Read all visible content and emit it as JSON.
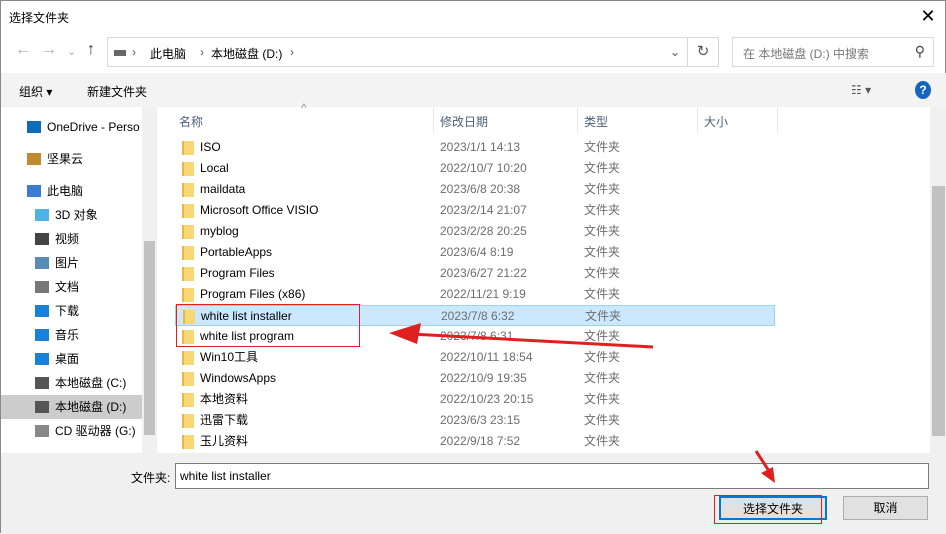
{
  "window": {
    "title": "选择文件夹",
    "close": "✕"
  },
  "nav": {
    "back": "←",
    "forward": "→",
    "recent": "⌄",
    "up": "↑"
  },
  "address": {
    "crumbs": [
      "此电脑",
      "本地磁盘 (D:)"
    ],
    "sep": "›",
    "dropdown": "⌄",
    "refresh": "↻"
  },
  "search": {
    "placeholder": "在 本地磁盘 (D:) 中搜索",
    "icon": "⚲"
  },
  "toolbar": {
    "organize": "组织 ▾",
    "new_folder": "新建文件夹",
    "view": "☷ ▾",
    "help": "?"
  },
  "sidebar": {
    "items": [
      {
        "label": "OneDrive - Perso",
        "icon": "cloud-icon",
        "color": "#0f6cbd"
      },
      {
        "label": "坚果云",
        "icon": "nut-icon",
        "color": "#c08a2e"
      },
      {
        "label": "此电脑",
        "icon": "computer-icon",
        "color": "#3a7bd5"
      },
      {
        "label": "3D 对象",
        "icon": "cube-icon",
        "color": "#4fb3e8"
      },
      {
        "label": "视频",
        "icon": "video-icon",
        "color": "#444"
      },
      {
        "label": "图片",
        "icon": "picture-icon",
        "color": "#5a8bb5"
      },
      {
        "label": "文档",
        "icon": "document-icon",
        "color": "#777"
      },
      {
        "label": "下载",
        "icon": "download-icon",
        "color": "#1e7fd6"
      },
      {
        "label": "音乐",
        "icon": "music-icon",
        "color": "#1e7fd6"
      },
      {
        "label": "桌面",
        "icon": "desktop-icon",
        "color": "#1e7fd6"
      },
      {
        "label": "本地磁盘 (C:)",
        "icon": "drive-icon",
        "color": "#555"
      },
      {
        "label": "本地磁盘 (D:)",
        "icon": "drive-icon",
        "color": "#555",
        "selected": true
      },
      {
        "label": "CD 驱动器 (G:)",
        "icon": "cd-icon",
        "color": "#888"
      }
    ]
  },
  "columns": [
    "名称",
    "修改日期",
    "类型",
    "大小"
  ],
  "files": [
    {
      "name": "ISO",
      "date": "2023/1/1 14:13",
      "type": "文件夹"
    },
    {
      "name": "Local",
      "date": "2022/10/7 10:20",
      "type": "文件夹"
    },
    {
      "name": "maildata",
      "date": "2023/6/8 20:38",
      "type": "文件夹"
    },
    {
      "name": "Microsoft Office VISIO",
      "date": "2023/2/14 21:07",
      "type": "文件夹"
    },
    {
      "name": "myblog",
      "date": "2023/2/28 20:25",
      "type": "文件夹"
    },
    {
      "name": "PortableApps",
      "date": "2023/6/4 8:19",
      "type": "文件夹"
    },
    {
      "name": "Program Files",
      "date": "2023/6/27 21:22",
      "type": "文件夹"
    },
    {
      "name": "Program Files (x86)",
      "date": "2022/11/21 9:19",
      "type": "文件夹"
    },
    {
      "name": "white list installer",
      "date": "2023/7/8 6:32",
      "type": "文件夹",
      "selected": true
    },
    {
      "name": "white list program",
      "date": "2023/7/8 6:31",
      "type": "文件夹"
    },
    {
      "name": "Win10工具",
      "date": "2022/10/11 18:54",
      "type": "文件夹"
    },
    {
      "name": "WindowsApps",
      "date": "2022/10/9 19:35",
      "type": "文件夹"
    },
    {
      "name": "本地资料",
      "date": "2022/10/23 20:15",
      "type": "文件夹"
    },
    {
      "name": "迅雷下载",
      "date": "2023/6/3 23:15",
      "type": "文件夹"
    },
    {
      "name": "玉儿资料",
      "date": "2022/9/18 7:52",
      "type": "文件夹"
    }
  ],
  "footer": {
    "folder_label": "文件夹:",
    "folder_value": "white list installer",
    "ok": "选择文件夹",
    "cancel": "取消"
  },
  "annotation_color": "#e02020"
}
